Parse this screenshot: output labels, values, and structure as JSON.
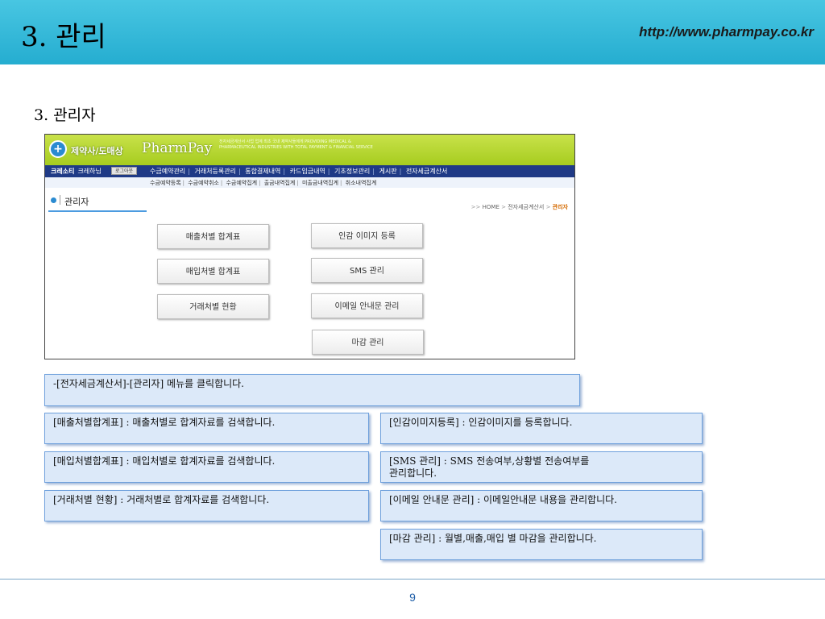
{
  "slide": {
    "title": "3. 관리",
    "url": "http://www.pharmpay.co.kr",
    "section_heading": "3. 관리자",
    "page_number": "9",
    "colors": {
      "header_bg": "#25add0",
      "callout_bg": "#dce9f9",
      "callout_border": "#6fa0dc",
      "nav_bg": "#1f3a86",
      "banner_bg": "#a6cc1f"
    }
  },
  "app": {
    "logo_text": "제약사/도매상",
    "brand": "PharmPay",
    "tagline": "전자세금계산서 사업 업계 최초 국내 제약사들에게 PROVIDING MEDICAL & PHARMACEUTICAL INDUSTRIES WITH TOTAL PAYMENT & FINANCIAL SERVICE",
    "user_label": "크레소티",
    "user_name": "크레하님",
    "logout_label": "로그아웃",
    "menu": [
      "수금예약관리",
      "거래처등록관리",
      "통합결제내역",
      "카드입금내역",
      "기초정보관리",
      "게시판",
      "전자세금계산서"
    ],
    "submenu": [
      "수금예약등록",
      "수금예약취소",
      "수금예약집계",
      "출금내역집계",
      "미출금내역집계",
      "취소내역집계"
    ],
    "page_title": "관리자",
    "breadcrumb": {
      "prefix": ">>",
      "home": "HOME",
      "parent": "전자세금계산서",
      "current": "관리자"
    },
    "buttons": {
      "sales_summary": "매출처별 합계표",
      "purchase_summary": "매입처별 합계표",
      "client_status": "거래처별 현황",
      "seal_image": "인감 이미지 등록",
      "sms": "SMS 관리",
      "email_notice": "이메일 안내문 관리",
      "closing": "마감 관리"
    }
  },
  "callouts": {
    "menu_click": "-[전자세금계산서]-[관리자] 메뉴를 클릭합니다.",
    "sales_summary": "[매출처별합계표] : 매출처별로 합계자료를 검색합니다.",
    "purchase_summary": "[매입처별합계표] : 매입처별로 합계자료를 검색합니다.",
    "client_status": "[거래처별 현황] : 거래처별로 합계자료를 검색합니다.",
    "seal_image": "[인감이미지등록] : 인감이미지를 등록합니다.",
    "sms_line1": "[SMS 관리] : SMS 전송여부,상황별 전송여부를",
    "sms_line2": "관리합니다.",
    "email_notice": "[이메일 안내문 관리] : 이메일안내문 내용을 관리합니다.",
    "closing": "[마감 관리] : 월별,매출,매입 별 마감을 관리합니다."
  }
}
